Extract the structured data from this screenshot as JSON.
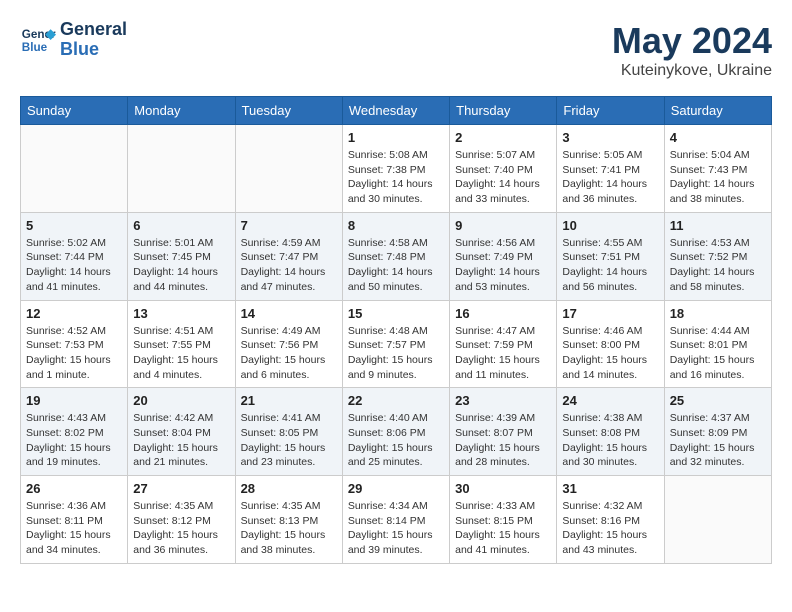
{
  "header": {
    "logo_line1": "General",
    "logo_line2": "Blue",
    "month": "May 2024",
    "location": "Kuteinykove, Ukraine"
  },
  "weekdays": [
    "Sunday",
    "Monday",
    "Tuesday",
    "Wednesday",
    "Thursday",
    "Friday",
    "Saturday"
  ],
  "weeks": [
    [
      {
        "day": "",
        "info": ""
      },
      {
        "day": "",
        "info": ""
      },
      {
        "day": "",
        "info": ""
      },
      {
        "day": "1",
        "info": "Sunrise: 5:08 AM\nSunset: 7:38 PM\nDaylight: 14 hours\nand 30 minutes."
      },
      {
        "day": "2",
        "info": "Sunrise: 5:07 AM\nSunset: 7:40 PM\nDaylight: 14 hours\nand 33 minutes."
      },
      {
        "day": "3",
        "info": "Sunrise: 5:05 AM\nSunset: 7:41 PM\nDaylight: 14 hours\nand 36 minutes."
      },
      {
        "day": "4",
        "info": "Sunrise: 5:04 AM\nSunset: 7:43 PM\nDaylight: 14 hours\nand 38 minutes."
      }
    ],
    [
      {
        "day": "5",
        "info": "Sunrise: 5:02 AM\nSunset: 7:44 PM\nDaylight: 14 hours\nand 41 minutes."
      },
      {
        "day": "6",
        "info": "Sunrise: 5:01 AM\nSunset: 7:45 PM\nDaylight: 14 hours\nand 44 minutes."
      },
      {
        "day": "7",
        "info": "Sunrise: 4:59 AM\nSunset: 7:47 PM\nDaylight: 14 hours\nand 47 minutes."
      },
      {
        "day": "8",
        "info": "Sunrise: 4:58 AM\nSunset: 7:48 PM\nDaylight: 14 hours\nand 50 minutes."
      },
      {
        "day": "9",
        "info": "Sunrise: 4:56 AM\nSunset: 7:49 PM\nDaylight: 14 hours\nand 53 minutes."
      },
      {
        "day": "10",
        "info": "Sunrise: 4:55 AM\nSunset: 7:51 PM\nDaylight: 14 hours\nand 56 minutes."
      },
      {
        "day": "11",
        "info": "Sunrise: 4:53 AM\nSunset: 7:52 PM\nDaylight: 14 hours\nand 58 minutes."
      }
    ],
    [
      {
        "day": "12",
        "info": "Sunrise: 4:52 AM\nSunset: 7:53 PM\nDaylight: 15 hours\nand 1 minute."
      },
      {
        "day": "13",
        "info": "Sunrise: 4:51 AM\nSunset: 7:55 PM\nDaylight: 15 hours\nand 4 minutes."
      },
      {
        "day": "14",
        "info": "Sunrise: 4:49 AM\nSunset: 7:56 PM\nDaylight: 15 hours\nand 6 minutes."
      },
      {
        "day": "15",
        "info": "Sunrise: 4:48 AM\nSunset: 7:57 PM\nDaylight: 15 hours\nand 9 minutes."
      },
      {
        "day": "16",
        "info": "Sunrise: 4:47 AM\nSunset: 7:59 PM\nDaylight: 15 hours\nand 11 minutes."
      },
      {
        "day": "17",
        "info": "Sunrise: 4:46 AM\nSunset: 8:00 PM\nDaylight: 15 hours\nand 14 minutes."
      },
      {
        "day": "18",
        "info": "Sunrise: 4:44 AM\nSunset: 8:01 PM\nDaylight: 15 hours\nand 16 minutes."
      }
    ],
    [
      {
        "day": "19",
        "info": "Sunrise: 4:43 AM\nSunset: 8:02 PM\nDaylight: 15 hours\nand 19 minutes."
      },
      {
        "day": "20",
        "info": "Sunrise: 4:42 AM\nSunset: 8:04 PM\nDaylight: 15 hours\nand 21 minutes."
      },
      {
        "day": "21",
        "info": "Sunrise: 4:41 AM\nSunset: 8:05 PM\nDaylight: 15 hours\nand 23 minutes."
      },
      {
        "day": "22",
        "info": "Sunrise: 4:40 AM\nSunset: 8:06 PM\nDaylight: 15 hours\nand 25 minutes."
      },
      {
        "day": "23",
        "info": "Sunrise: 4:39 AM\nSunset: 8:07 PM\nDaylight: 15 hours\nand 28 minutes."
      },
      {
        "day": "24",
        "info": "Sunrise: 4:38 AM\nSunset: 8:08 PM\nDaylight: 15 hours\nand 30 minutes."
      },
      {
        "day": "25",
        "info": "Sunrise: 4:37 AM\nSunset: 8:09 PM\nDaylight: 15 hours\nand 32 minutes."
      }
    ],
    [
      {
        "day": "26",
        "info": "Sunrise: 4:36 AM\nSunset: 8:11 PM\nDaylight: 15 hours\nand 34 minutes."
      },
      {
        "day": "27",
        "info": "Sunrise: 4:35 AM\nSunset: 8:12 PM\nDaylight: 15 hours\nand 36 minutes."
      },
      {
        "day": "28",
        "info": "Sunrise: 4:35 AM\nSunset: 8:13 PM\nDaylight: 15 hours\nand 38 minutes."
      },
      {
        "day": "29",
        "info": "Sunrise: 4:34 AM\nSunset: 8:14 PM\nDaylight: 15 hours\nand 39 minutes."
      },
      {
        "day": "30",
        "info": "Sunrise: 4:33 AM\nSunset: 8:15 PM\nDaylight: 15 hours\nand 41 minutes."
      },
      {
        "day": "31",
        "info": "Sunrise: 4:32 AM\nSunset: 8:16 PM\nDaylight: 15 hours\nand 43 minutes."
      },
      {
        "day": "",
        "info": ""
      }
    ]
  ]
}
